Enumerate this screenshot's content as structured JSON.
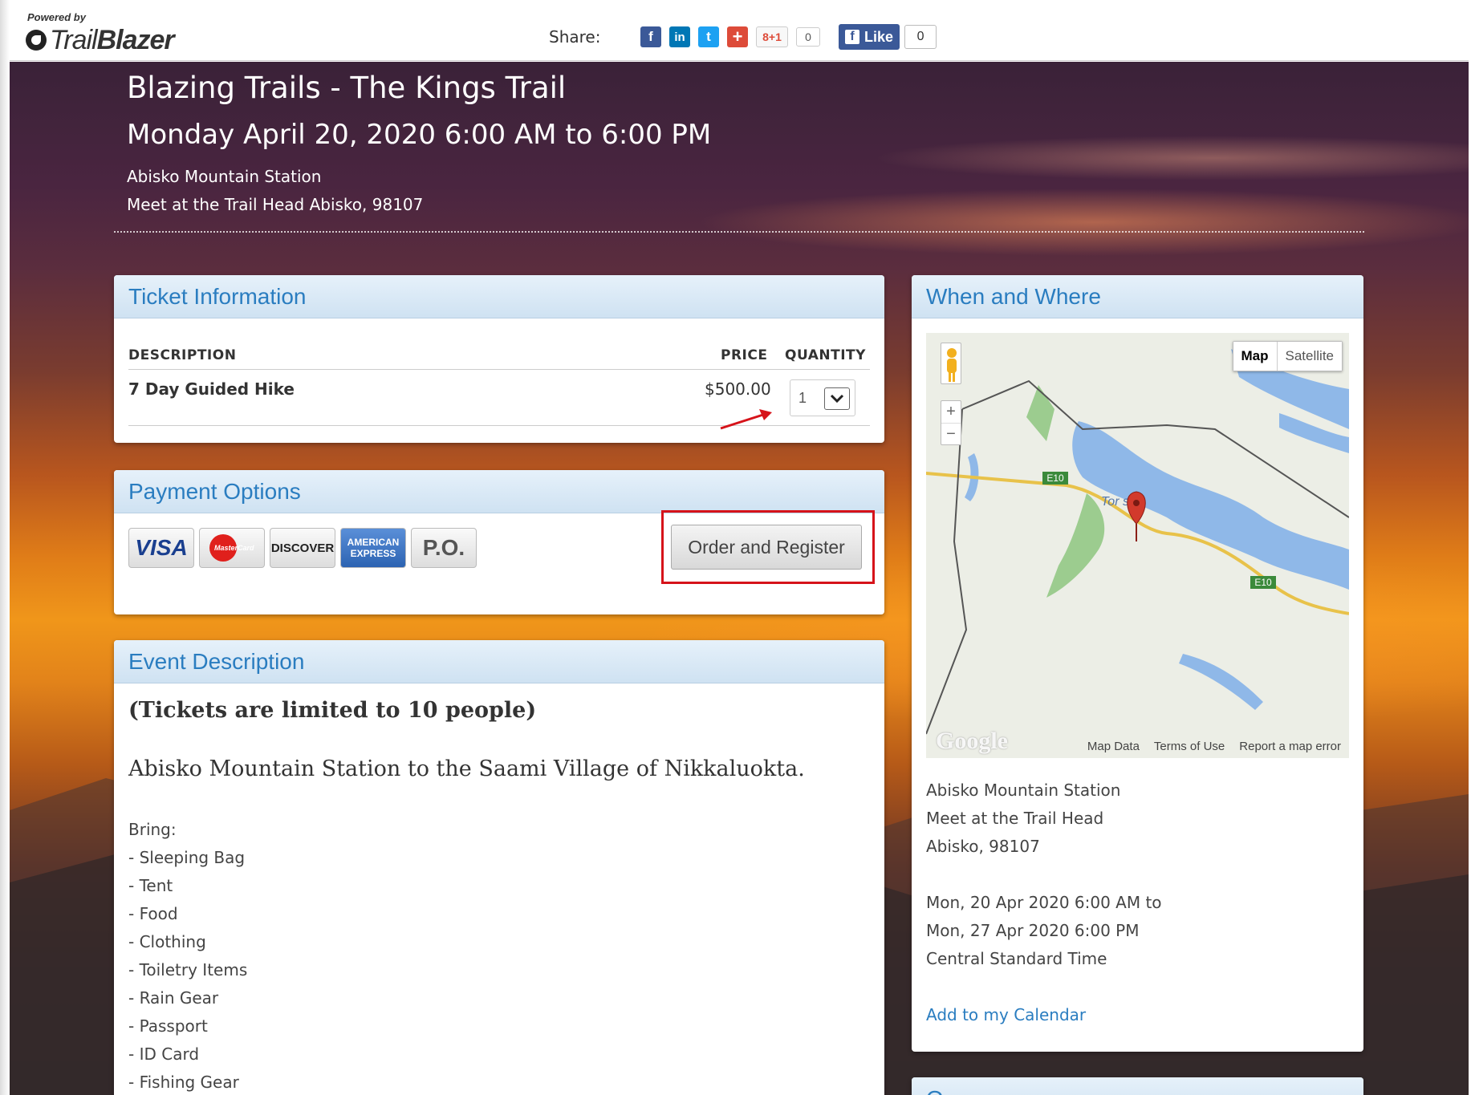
{
  "header": {
    "powered_by": "Powered by",
    "logo_text_light": "Trail",
    "logo_text_bold": "Blazer",
    "share_label": "Share:",
    "share_icons": [
      {
        "name": "facebook-icon",
        "glyph": "f",
        "color": "#3b5998"
      },
      {
        "name": "linkedin-icon",
        "glyph": "in",
        "color": "#0077b5"
      },
      {
        "name": "twitter-icon",
        "glyph": "t",
        "color": "#1da1f2"
      },
      {
        "name": "google-plus-share-icon",
        "glyph": "+",
        "color": "#dd4b39"
      }
    ],
    "gplus_label": "8+1",
    "gplus_count": "0",
    "fb_like_label": "Like",
    "fb_like_count": "0"
  },
  "hero": {
    "title": "Blazing Trails - The Kings Trail",
    "date": "Monday April 20, 2020 6:00 AM to 6:00 PM",
    "location_line1": "Abisko Mountain Station",
    "location_line2": "Meet at the Trail Head Abisko, 98107"
  },
  "ticket": {
    "heading": "Ticket Information",
    "col_description": "DESCRIPTION",
    "col_price": "PRICE",
    "col_quantity": "QUANTITY",
    "item_name": "7 Day Guided Hike",
    "item_price": "$500.00",
    "item_quantity": "1"
  },
  "payment": {
    "heading": "Payment Options",
    "cards": {
      "visa": "VISA",
      "mastercard": "MasterCard",
      "discover": "DISCOVER",
      "amex": "AMERICAN EXPRESS",
      "po": "P.O."
    },
    "order_button": "Order and Register"
  },
  "event": {
    "heading": "Event Description",
    "limit": "(Tickets are limited to 10 people)",
    "route": "Abisko Mountain Station to the Saami Village of Nikkaluokta.",
    "bring_label": "Bring:",
    "bring_items": [
      "- Sleeping Bag",
      "- Tent",
      "- Food",
      "- Clothing",
      "- Toiletry Items",
      "- Rain Gear",
      "- Passport",
      "- ID Card",
      "- Fishing Gear"
    ]
  },
  "where": {
    "heading": "When and Where",
    "map": {
      "type_map": "Map",
      "type_satellite": "Satellite",
      "zoom_in": "+",
      "zoom_out": "−",
      "road_label_1": "E10",
      "road_label_2": "E10",
      "town_label": "Tor    sk",
      "google": "Google",
      "map_data": "Map Data",
      "terms": "Terms of Use",
      "report": "Report a map error"
    },
    "address1": "Abisko Mountain Station",
    "address2": "Meet at the Trail Head",
    "address3": "Abisko, 98107",
    "time1": "Mon, 20 Apr 2020 6:00 AM to",
    "time2": "Mon, 27 Apr 2020 6:00 PM",
    "timezone": "Central Standard Time",
    "add_calendar": "Add to my Calendar"
  },
  "next_panel": {
    "heading": "O"
  },
  "colors": {
    "accent_blue": "#2a7dc0",
    "highlight_red": "#d6131a"
  }
}
